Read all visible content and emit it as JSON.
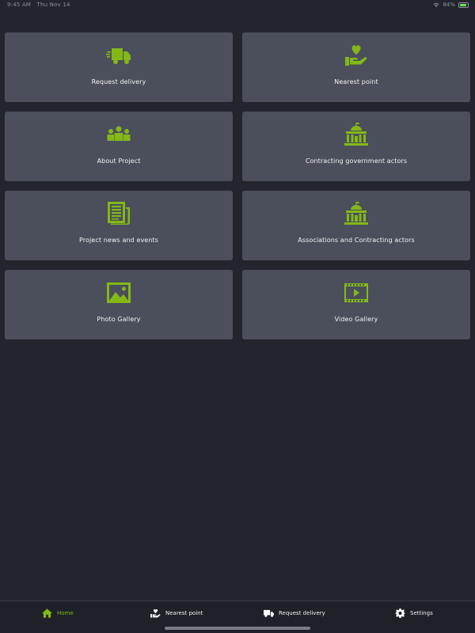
{
  "status_bar": {
    "time": "9:45 AM",
    "date": "Thu Nov 14",
    "battery": "84%",
    "battery_color": "#6ee05a",
    "icons": [
      "wifi-icon",
      "battery-icon"
    ]
  },
  "accent_color": "#84b817",
  "tiles": [
    {
      "label": "Request delivery",
      "icon": "delivery-truck-icon"
    },
    {
      "label": "Nearest point",
      "icon": "heart-hand-icon"
    },
    {
      "label": "About Project",
      "icon": "people-group-icon"
    },
    {
      "label": "Contracting government actors",
      "icon": "government-building-icon"
    },
    {
      "label": "Project news and events",
      "icon": "newspaper-icon"
    },
    {
      "label": "Associations and Contracting actors",
      "icon": "government-building-icon"
    },
    {
      "label": "Photo Gallery",
      "icon": "image-icon"
    },
    {
      "label": "Video Gallery",
      "icon": "video-icon"
    }
  ],
  "tabbar": {
    "items": [
      {
        "label": "Home",
        "icon": "home-icon",
        "active": true
      },
      {
        "label": "Nearest point",
        "icon": "heart-hand-icon",
        "active": false
      },
      {
        "label": "Request delivery",
        "icon": "delivery-truck-icon",
        "active": false
      },
      {
        "label": "Settings",
        "icon": "gear-icon",
        "active": false
      }
    ]
  }
}
